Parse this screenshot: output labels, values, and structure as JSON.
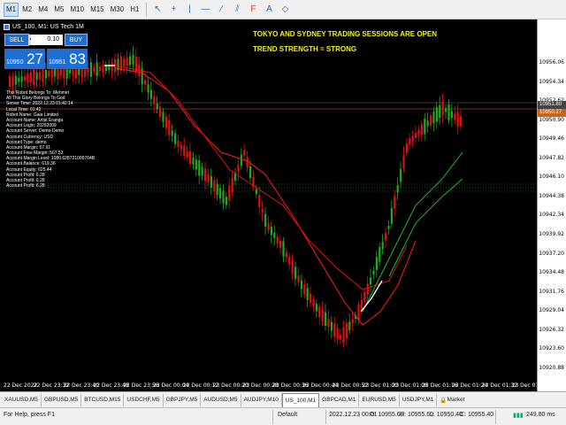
{
  "toolbar": {
    "timeframes": [
      "M1",
      "M2",
      "M4",
      "M5",
      "M10",
      "M15",
      "M30",
      "H1"
    ],
    "active_timeframe": "M1",
    "tools": [
      "cursor-icon",
      "crosshair-icon",
      "vertical-line-icon",
      "horizontal-line-icon",
      "trend-line-icon",
      "equidistant-channel-icon",
      "fibonacci-icon",
      "text-icon",
      "shapes-icon"
    ]
  },
  "chart": {
    "symbol": "US_100, M1:  US Tech 1M",
    "trade_panel": {
      "sell_label": "SELL",
      "buy_label": "BUY",
      "lot": "0.10",
      "bid_small": "10950",
      "bid_big": "27",
      "ask_small": "10951",
      "ask_big": "83"
    },
    "info_lines": [
      "This Robot Belongs To: Mehmet",
      "All This Glory Belongs To God",
      "Server Time: 2022.12.23 01:42:14",
      "Local Time: 01:42",
      "Robot Name: Gaia Limited",
      "Account Name: Artist Eranga",
      "Account Login: 20292009",
      "Account Server: Demo-Demo",
      "Account Currency: USD",
      "Account Type: demo",
      "Account Margin: 57.91",
      "Account Free Margin: 567.53",
      "Account Margin Level: 1080.628721009704B",
      "Account Balance: 619.36",
      "Account Equity: 625.44",
      "Account Profit: 6.28",
      "Account Profit: 6.28",
      "Account Profit: 6.28"
    ],
    "banner_line1": "TOKYO AND SYDNEY TRADING SESSIONS ARE OPEN",
    "banner_line2": "TREND STRENGTH = STRONG",
    "price_labels": [
      "10956.06",
      "10954.34",
      "10952.62",
      "10950.90",
      "10949.46",
      "10947.82",
      "10946.10",
      "10944.38",
      "10942.34",
      "10939.92",
      "10937.20",
      "10934.48",
      "10931.76",
      "10929.04",
      "10926.32",
      "10923.60",
      "10920.88"
    ],
    "highlight_labels": [
      "10951.80",
      "10950.27"
    ],
    "time_labels": [
      "22 Dec 2022",
      "22 Dec 23:32",
      "22 Dec 23:40",
      "22 Dec 23:48",
      "22 Dec 23:56",
      "23 Dec 00:04",
      "23 Dec 00:12",
      "23 Dec 00:20",
      "23 Dec 00:28",
      "23 Dec 00:36",
      "23 Dec 00:44",
      "23 Dec 00:52",
      "23 Dec 01:00",
      "23 Dec 01:08",
      "23 Dec 01:16",
      "23 Dec 01:24",
      "23 Dec 01:32",
      "23 Dec 01:40"
    ],
    "colors": {
      "bull": "#1faa1f",
      "bear": "#e01010",
      "ma_fast": "#ff1a1a",
      "ma_slow": "#e01010",
      "ma_green": "#1fb81f",
      "banner": "#f4f40c",
      "accent": "#1e6fd1"
    }
  },
  "tabs": [
    "XAUUSD,M5",
    "GBPUSD,M5",
    "BTCUSD,M15",
    "USDCHF,M5",
    "GBPJPY,M5",
    "AUDUSD,M5",
    "AUDJPY,M10",
    "US_100,M1",
    "GBPCAD,M1",
    "EURUSD,M5",
    "USDJPY,M1",
    "Market"
  ],
  "active_tab": "US_100,M1",
  "status": {
    "help": "For Help, press F1",
    "profile": "Default",
    "time": "2022.12.23 00:01",
    "open": "O: 10955.60",
    "high": "H: 10955.60",
    "low": "L: 10950.40",
    "close": "C: 10955.40",
    "traffic": "249.80 ms"
  }
}
